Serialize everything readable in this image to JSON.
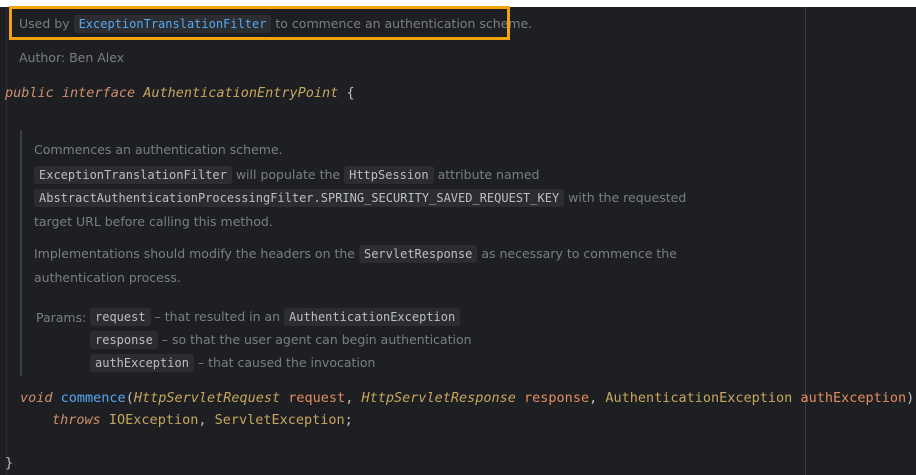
{
  "header_doc": {
    "used_by_prefix": "Used by",
    "used_by_class": "ExceptionTranslationFilter",
    "used_by_suffix": "to commence an authentication scheme.",
    "author_label": "Author:",
    "author_name": "Ben Alex"
  },
  "declaration": {
    "kw_public": "public",
    "kw_interface": "interface",
    "name": "AuthenticationEntryPoint",
    "brace_open": "{",
    "brace_close": "}"
  },
  "method_doc": {
    "line1": "Commences an authentication scheme.",
    "l2_chip1": "ExceptionTranslationFilter",
    "l2_text1": "will populate the",
    "l2_chip2": "HttpSession",
    "l2_text2": "attribute named",
    "l3_chip": "AbstractAuthenticationProcessingFilter.SPRING_SECURITY_SAVED_REQUEST_KEY",
    "l3_text": "with the requested",
    "l4_text": "target URL before calling this method.",
    "l5_text1": "Implementations should modify the headers on the",
    "l5_chip": "ServletResponse",
    "l5_text2": "as necessary to commence the",
    "l6_text": "authentication process.",
    "params_label": "Params:",
    "params": [
      {
        "name": "request",
        "desc": "– that resulted in an",
        "chip": "AuthenticationException"
      },
      {
        "name": "response",
        "desc": "– so that the user agent can begin authentication",
        "chip": ""
      },
      {
        "name": "authException",
        "desc": "– that caused the invocation",
        "chip": ""
      }
    ]
  },
  "method_sig": {
    "kw_void": "void",
    "name": "commence",
    "p1_type": "HttpServletRequest",
    "p1_name": "request",
    "p2_type": "HttpServletResponse",
    "p2_name": "response",
    "p3_type": "AuthenticationException",
    "p3_name": "authException",
    "kw_throws": "throws",
    "ex1": "IOException",
    "ex2": "ServletException"
  },
  "colors": {
    "highlight": "#f2a20d",
    "background": "#1e1f22"
  }
}
